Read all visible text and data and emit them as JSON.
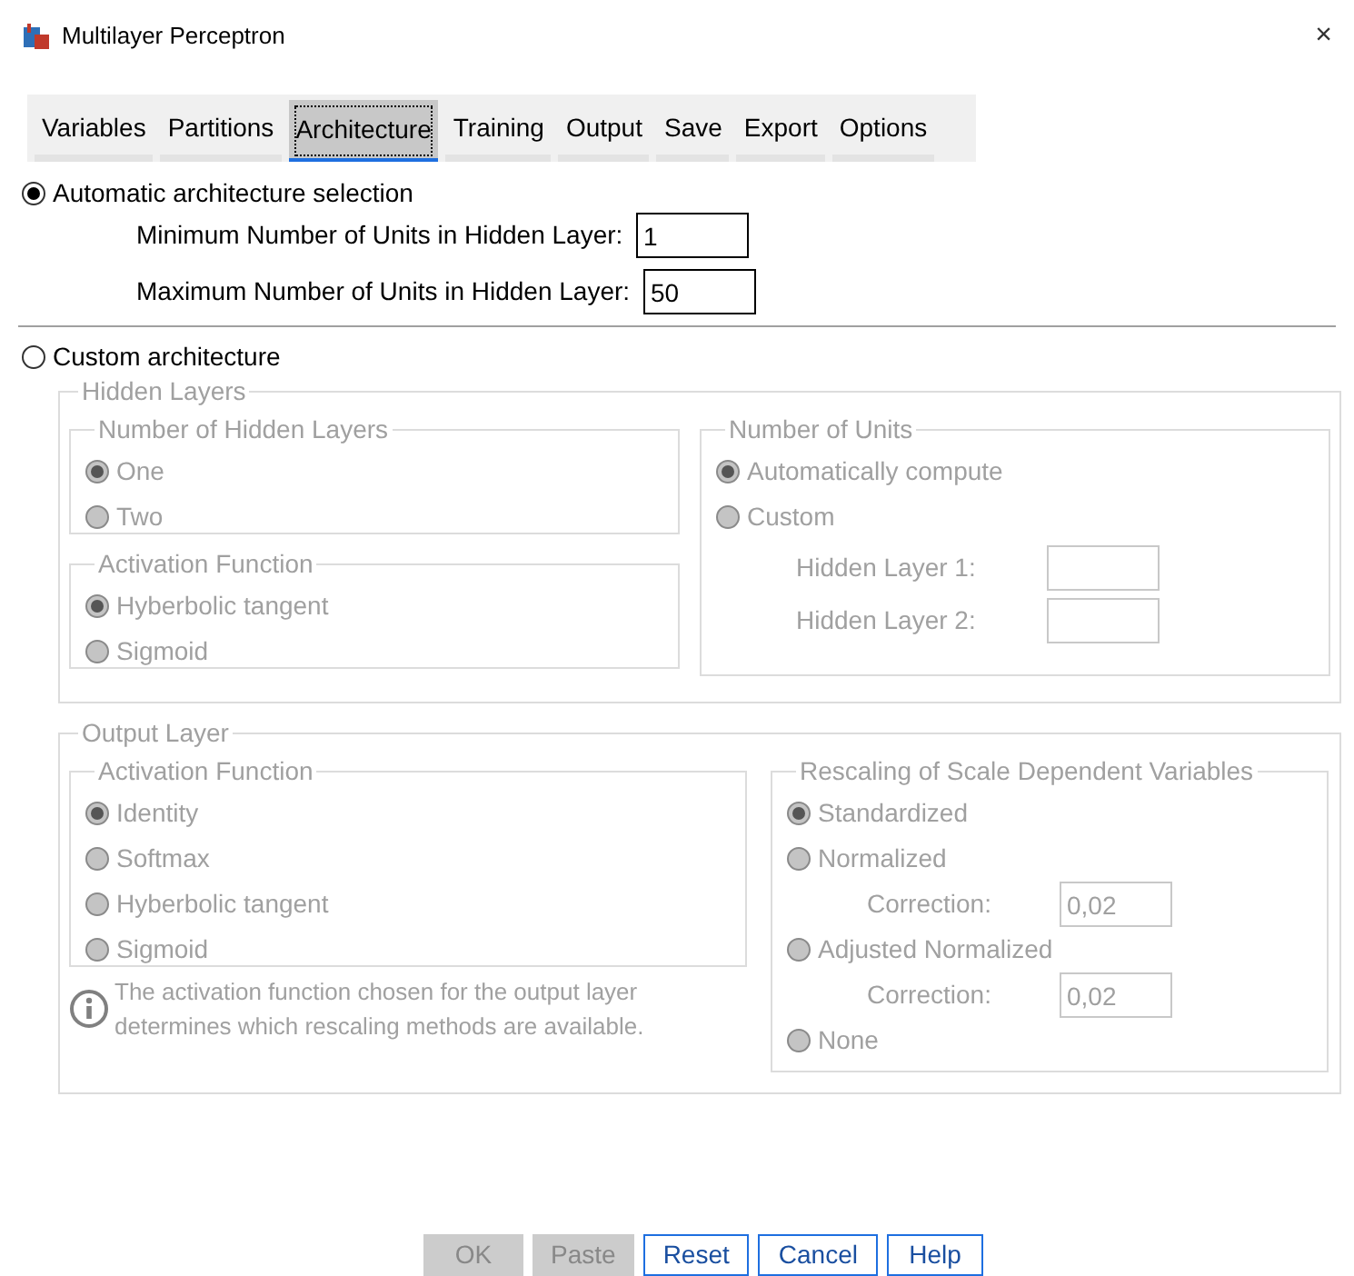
{
  "window": {
    "title": "Multilayer Perceptron",
    "close": "×"
  },
  "tabs": [
    {
      "label": "Variables",
      "selected": false
    },
    {
      "label": "Partitions",
      "selected": false
    },
    {
      "label": "Architecture",
      "selected": true
    },
    {
      "label": "Training",
      "selected": false
    },
    {
      "label": "Output",
      "selected": false
    },
    {
      "label": "Save",
      "selected": false
    },
    {
      "label": "Export",
      "selected": false
    },
    {
      "label": "Options",
      "selected": false
    }
  ],
  "automatic": {
    "label": "Automatic architecture selection",
    "selected": true,
    "fields": [
      {
        "label": "Minimum Number of Units in Hidden Layer:",
        "value": "1"
      },
      {
        "label": "Maximum Number of Units in Hidden Layer:",
        "value": "50"
      }
    ]
  },
  "custom": {
    "label": "Custom architecture",
    "selected": false
  },
  "hidden_layers": {
    "title": "Hidden Layers",
    "disabled": true,
    "number_of_hidden_layers": {
      "title": "Number of Hidden Layers",
      "options": [
        {
          "label": "One",
          "selected": true
        },
        {
          "label": "Two",
          "selected": false
        }
      ]
    },
    "activation_function": {
      "title": "Activation Function",
      "options": [
        {
          "label": "Hyberbolic tangent",
          "selected": true
        },
        {
          "label": "Sigmoid",
          "selected": false
        }
      ]
    },
    "number_of_units": {
      "title": "Number of Units",
      "options": [
        {
          "label": "Automatically compute",
          "selected": true
        },
        {
          "label": "Custom",
          "selected": false
        }
      ],
      "fields": [
        {
          "label": "Hidden Layer 1:"
        },
        {
          "label": "Hidden Layer 2:"
        }
      ]
    }
  },
  "output_layer": {
    "title": "Output Layer",
    "disabled": true,
    "activation_function": {
      "title": "Activation Function",
      "options": [
        {
          "label": "Identity",
          "selected": true
        },
        {
          "label": "Softmax",
          "selected": false
        },
        {
          "label": "Hyberbolic tangent",
          "selected": false
        },
        {
          "label": "Sigmoid",
          "selected": false
        }
      ]
    },
    "note": "The activation function chosen for the output layer determines which rescaling methods are available.",
    "rescaling": {
      "title": "Rescaling of Scale Dependent Variables",
      "options": [
        {
          "label": "Standardized",
          "selected": true
        },
        {
          "label": "Normalized",
          "selected": false,
          "correction": {
            "label": "Correction:",
            "value": "0,02"
          }
        },
        {
          "label": "Adjusted Normalized",
          "selected": false,
          "correction": {
            "label": "Correction:",
            "value": "0,02"
          }
        },
        {
          "label": "None",
          "selected": false
        }
      ]
    }
  },
  "buttons": [
    {
      "label": "OK",
      "disabled": true
    },
    {
      "label": "Paste",
      "disabled": true
    },
    {
      "label": "Reset",
      "disabled": false
    },
    {
      "label": "Cancel",
      "disabled": false
    },
    {
      "label": "Help",
      "disabled": false
    }
  ]
}
